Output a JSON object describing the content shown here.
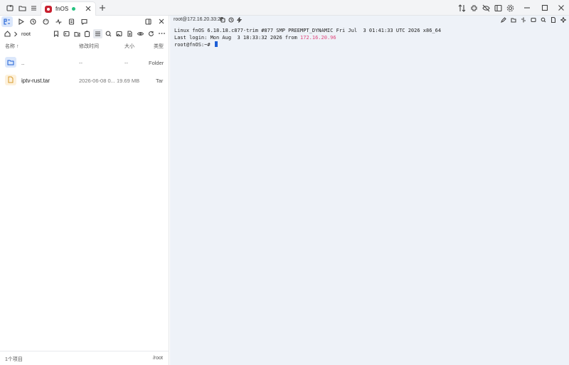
{
  "tab": {
    "label": "fnOS"
  },
  "file_panel": {
    "path": "root",
    "columns": {
      "name": "名称 ↑",
      "modified": "修改时间",
      "size": "大小",
      "type": "类型"
    },
    "rows": [
      {
        "name": "..",
        "modified": "--",
        "size": "--",
        "type": "Folder",
        "icon": "folder-icon"
      },
      {
        "name": "iptv-rust.tar",
        "modified": "2026-06-08 0...",
        "size": "19.69 MB",
        "type": "Tar",
        "icon": "archive-file-icon"
      }
    ],
    "status_count": "1个项目",
    "status_path": "/root"
  },
  "terminal": {
    "host_label": "root@172.16.20.33:22",
    "line1": "Linux fnOS 6.18.18.c877-trim #877 SMP PREEMPT_DYNAMIC Fri Jul  3 01:41:33 UTC 2026 x86_64",
    "line2_prefix": "Last login: Mon Aug  3 18:33:32 2026 from ",
    "line2_ip": "172.16.20.96",
    "prompt": "root@fnOS:~# "
  },
  "colors": {
    "accent": "#1d5fd6",
    "brand": "#c8202f",
    "online": "#26c281",
    "ip_highlight": "#e0457b",
    "terminal_bg": "#eef2f8"
  }
}
